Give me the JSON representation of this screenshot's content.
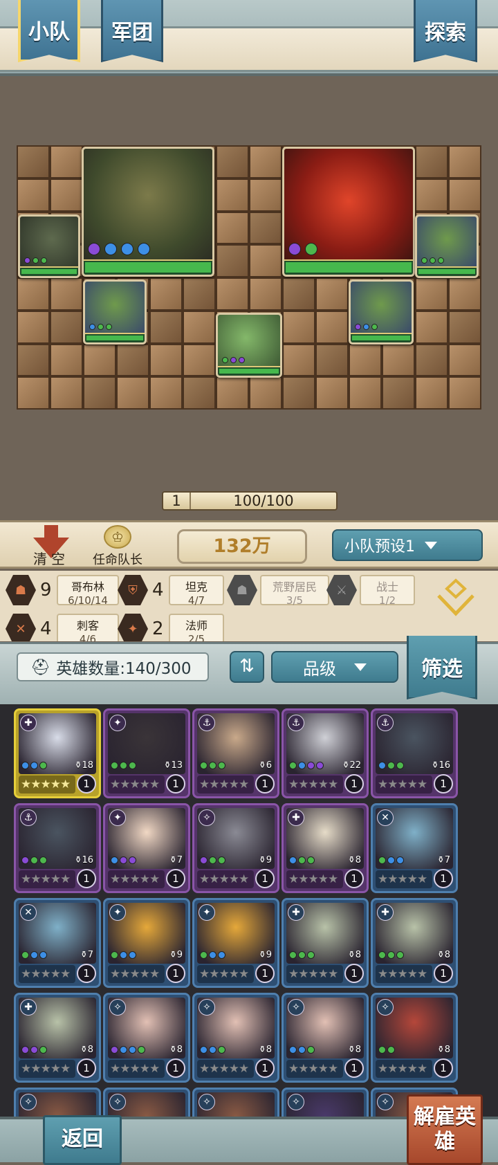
{
  "tabs": {
    "squad": "小队",
    "legion": "军团",
    "explore": "探索"
  },
  "board": {
    "level": "1",
    "hp": "100/100",
    "units": [
      {
        "name": "steam-golem-unit",
        "dots": [
          "p",
          "b",
          "b",
          "b"
        ]
      },
      {
        "name": "fire-beast-unit",
        "dots": [
          "p",
          "g"
        ]
      },
      {
        "name": "goblin-scythe-unit",
        "dots": [
          "p",
          "g",
          "g"
        ]
      },
      {
        "name": "goblin-warrior-unit-right",
        "dots": [
          "g",
          "g",
          "g"
        ]
      },
      {
        "name": "goblin-warrior-unit-left",
        "dots": [
          "b",
          "g",
          "g"
        ]
      },
      {
        "name": "goblin-warrior-unit-mid-right",
        "dots": [
          "p",
          "b",
          "g"
        ]
      },
      {
        "name": "orc-brute-unit",
        "dots": [
          "g",
          "p",
          "p"
        ]
      }
    ]
  },
  "teambar": {
    "clear": "清空",
    "leader": "任命队长",
    "power": "132万",
    "preset": "小队预设1"
  },
  "synergies": [
    {
      "icon": "goblin-icon",
      "count": "9",
      "name": "哥布林",
      "progress": "6/10/14",
      "active": true
    },
    {
      "icon": "tank-icon",
      "count": "4",
      "name": "坦克",
      "progress": "4/7",
      "active": true
    },
    {
      "icon": "wild-icon",
      "count": "",
      "name": "荒野居民",
      "progress": "3/5",
      "active": false
    },
    {
      "icon": "warrior-icon",
      "count": "",
      "name": "战士",
      "progress": "1/2",
      "active": false
    },
    {
      "icon": "assassin-icon",
      "count": "4",
      "name": "刺客",
      "progress": "4/6",
      "active": true
    },
    {
      "icon": "mage-icon",
      "count": "2",
      "name": "法师",
      "progress": "2/5",
      "active": true
    }
  ],
  "roster": {
    "hero_count": "英雄数量:140/300",
    "grade": "品级",
    "filter": "筛选"
  },
  "heroes": [
    {
      "tier": "gold",
      "cls": "✚",
      "power": "18",
      "level": "1",
      "dots": [
        "b",
        "b",
        "g"
      ],
      "color": "#d8dce8"
    },
    {
      "tier": "purple",
      "cls": "✦",
      "power": "13",
      "level": "1",
      "dots": [
        "g",
        "g",
        "g"
      ],
      "color": "#3a3438"
    },
    {
      "tier": "purple",
      "cls": "⚓",
      "power": "6",
      "level": "1",
      "dots": [
        "g",
        "g",
        "g"
      ],
      "color": "#c9a98a"
    },
    {
      "tier": "purple",
      "cls": "⚓",
      "power": "22",
      "level": "1",
      "dots": [
        "g",
        "b",
        "p",
        "p"
      ],
      "color": "#cfd0d6"
    },
    {
      "tier": "purple",
      "cls": "⚓",
      "power": "16",
      "level": "1",
      "dots": [
        "b",
        "g",
        "g"
      ],
      "color": "#4a5460"
    },
    {
      "tier": "purple",
      "cls": "⚓",
      "power": "16",
      "level": "1",
      "dots": [
        "p",
        "g",
        "g"
      ],
      "color": "#4a5460"
    },
    {
      "tier": "purple",
      "cls": "✦",
      "power": "7",
      "level": "1",
      "dots": [
        "b",
        "p",
        "p"
      ],
      "color": "#f1d8c4"
    },
    {
      "tier": "purple",
      "cls": "✧",
      "power": "9",
      "level": "1",
      "dots": [
        "p",
        "g",
        "g"
      ],
      "color": "#8a8a94"
    },
    {
      "tier": "purple",
      "cls": "✚",
      "power": "8",
      "level": "1",
      "dots": [
        "b",
        "g",
        "g"
      ],
      "color": "#e6dcc8"
    },
    {
      "tier": "blue",
      "cls": "✕",
      "power": "7",
      "level": "1",
      "dots": [
        "g",
        "b",
        "b"
      ],
      "color": "#7fb0c8"
    },
    {
      "tier": "blue",
      "cls": "✕",
      "power": "7",
      "level": "1",
      "dots": [
        "g",
        "b",
        "b"
      ],
      "color": "#7fb0c8"
    },
    {
      "tier": "blue",
      "cls": "✦",
      "power": "9",
      "level": "1",
      "dots": [
        "g",
        "b",
        "b"
      ],
      "color": "#e5a83a"
    },
    {
      "tier": "blue",
      "cls": "✦",
      "power": "9",
      "level": "1",
      "dots": [
        "g",
        "b",
        "b"
      ],
      "color": "#e5a83a"
    },
    {
      "tier": "blue",
      "cls": "✚",
      "power": "8",
      "level": "1",
      "dots": [
        "g",
        "g",
        "g"
      ],
      "color": "#b8c2a8"
    },
    {
      "tier": "blue",
      "cls": "✚",
      "power": "8",
      "level": "1",
      "dots": [
        "g",
        "g",
        "g"
      ],
      "color": "#b8c2a8"
    },
    {
      "tier": "blue",
      "cls": "✚",
      "power": "8",
      "level": "1",
      "dots": [
        "p",
        "p",
        "g"
      ],
      "color": "#b8c2a8"
    },
    {
      "tier": "blue",
      "cls": "✧",
      "power": "8",
      "level": "1",
      "dots": [
        "p",
        "b",
        "b",
        "g"
      ],
      "color": "#e2c0b4"
    },
    {
      "tier": "blue",
      "cls": "✧",
      "power": "8",
      "level": "1",
      "dots": [
        "b",
        "b",
        "g"
      ],
      "color": "#e2c0b4"
    },
    {
      "tier": "blue",
      "cls": "✧",
      "power": "8",
      "level": "1",
      "dots": [
        "b",
        "b",
        "g"
      ],
      "color": "#e2c0b4"
    },
    {
      "tier": "blue",
      "cls": "✧",
      "power": "8",
      "level": "1",
      "dots": [
        "g",
        "g"
      ],
      "color": "#b5473a"
    },
    {
      "tier": "blue",
      "cls": "✧",
      "power": "",
      "level": "",
      "dots": [],
      "color": "#8a5a44"
    },
    {
      "tier": "blue",
      "cls": "✧",
      "power": "",
      "level": "",
      "dots": [],
      "color": "#8a5a44"
    },
    {
      "tier": "blue",
      "cls": "✧",
      "power": "",
      "level": "",
      "dots": [],
      "color": "#8a5a44"
    },
    {
      "tier": "blue",
      "cls": "✧",
      "power": "",
      "level": "",
      "dots": [],
      "color": "#4a3a6a"
    },
    {
      "tier": "blue",
      "cls": "✧",
      "power": "",
      "level": "",
      "dots": [],
      "color": "#8a5a44"
    }
  ],
  "bottom": {
    "back": "返回",
    "dismiss": "解雇英雄"
  }
}
